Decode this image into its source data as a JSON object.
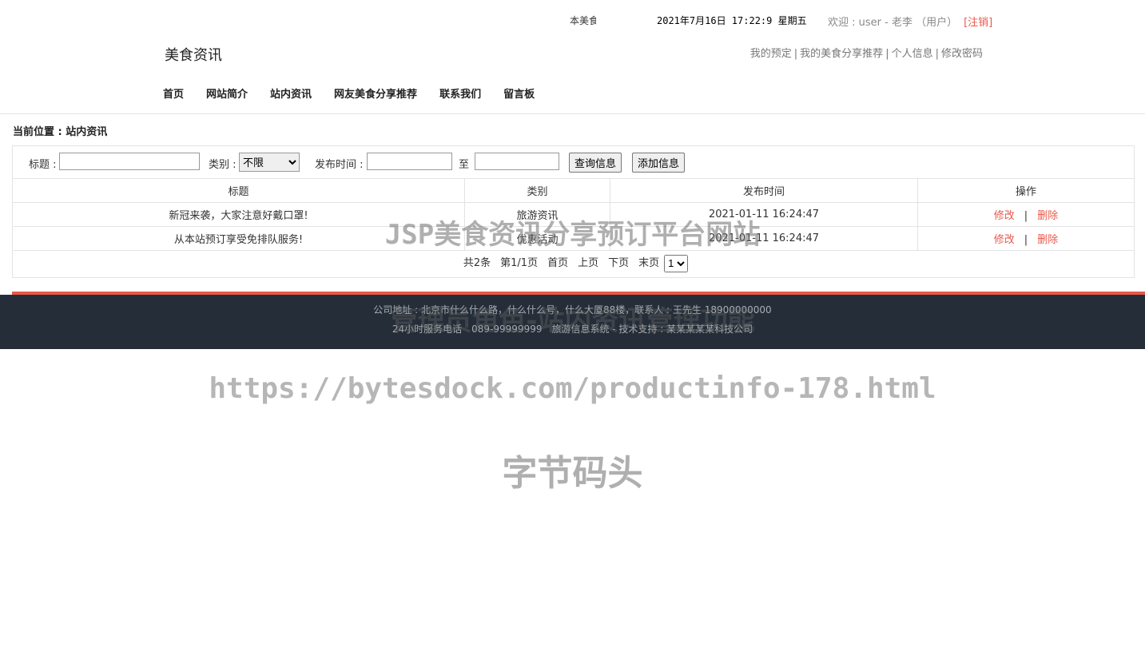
{
  "topbar": {
    "marquee": "本美食",
    "datetime": "2021年7月16日 17:22:9 星期五",
    "welcome": "欢迎 : user - 老李 （用户）",
    "logout": "[注销]"
  },
  "header": {
    "site_title": "美食资讯",
    "user_links": [
      "我的预定",
      "我的美食分享推荐",
      "个人信息",
      "修改密码"
    ],
    "separator": "|"
  },
  "nav": {
    "items": [
      "首页",
      "网站简介",
      "站内资讯",
      "网友美食分享推荐",
      "联系我们",
      "留言板"
    ]
  },
  "breadcrumb": "当前位置 : 站内资讯",
  "search": {
    "title_label": "标题 :",
    "title_value": "",
    "category_label": "类别 :",
    "category_selected": "不限",
    "time_label": "发布时间 :",
    "time_from": "",
    "to_label": "至",
    "time_to": "",
    "query_button": "查询信息",
    "add_button": "添加信息"
  },
  "table": {
    "headers": [
      "标题",
      "类别",
      "发布时间",
      "操作"
    ],
    "rows": [
      {
        "title": "新冠来袭，大家注意好戴口罩!",
        "category": "旅游资讯",
        "time": "2021-01-11 16:24:47",
        "edit": "修改",
        "sep": "|",
        "delete": "删除"
      },
      {
        "title": "从本站预订享受免排队服务!",
        "category": "优惠活动",
        "time": "2021-01-11 16:24:47",
        "edit": "修改",
        "sep": "|",
        "delete": "删除"
      }
    ]
  },
  "pager": {
    "total": "共2条",
    "page": "第1/1页",
    "first": "首页",
    "prev": "上页",
    "next": "下页",
    "last": "末页",
    "page_select": "1"
  },
  "footer": {
    "line1": "公司地址 : 北京市什么什么路，什么什么号，什么大厦88楼，联系人 : 王先生 18900000000",
    "line2": "24小时服务电话　089-99999999　旅游信息系统 - 技术支持 : 某某某某某科技公司"
  },
  "watermarks": {
    "w1": "JSP美食资讯分享预订平台网站",
    "w2": "管理员角色-站内资讯管理功能",
    "w3": "https://bytesdock.com/productinfo-178.html",
    "w4": "字节码头"
  },
  "colors": {
    "accent": "#e8584a",
    "footer_bg": "#252e38"
  }
}
